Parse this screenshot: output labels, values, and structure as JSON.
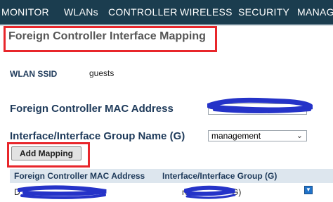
{
  "nav": {
    "items": [
      "MONITOR",
      "WLANs",
      "CONTROLLER",
      "WIRELESS",
      "SECURITY",
      "MANAGE"
    ]
  },
  "page": {
    "title": "Foreign Controller Interface Mapping"
  },
  "wlan": {
    "ssid_label": "WLAN SSID",
    "ssid_value": "guests"
  },
  "form": {
    "mac_label": "Foreign Controller MAC Address",
    "mac_select_value": "",
    "iface_label": "Interface/Interface Group Name (G)",
    "iface_select_value": "management",
    "add_button": "Add Mapping"
  },
  "table": {
    "headers": [
      "Foreign Controller MAC Address",
      "Interface/Interface Group (G)"
    ],
    "rows": [
      {
        "mac": "D",
        "iface": "re",
        "iface_suffix": "G)"
      }
    ]
  },
  "colors": {
    "nav_bg": "#1b3d4f",
    "highlight": "#e8262b",
    "label": "#1e3a5a",
    "redaction": "#2533c8"
  }
}
